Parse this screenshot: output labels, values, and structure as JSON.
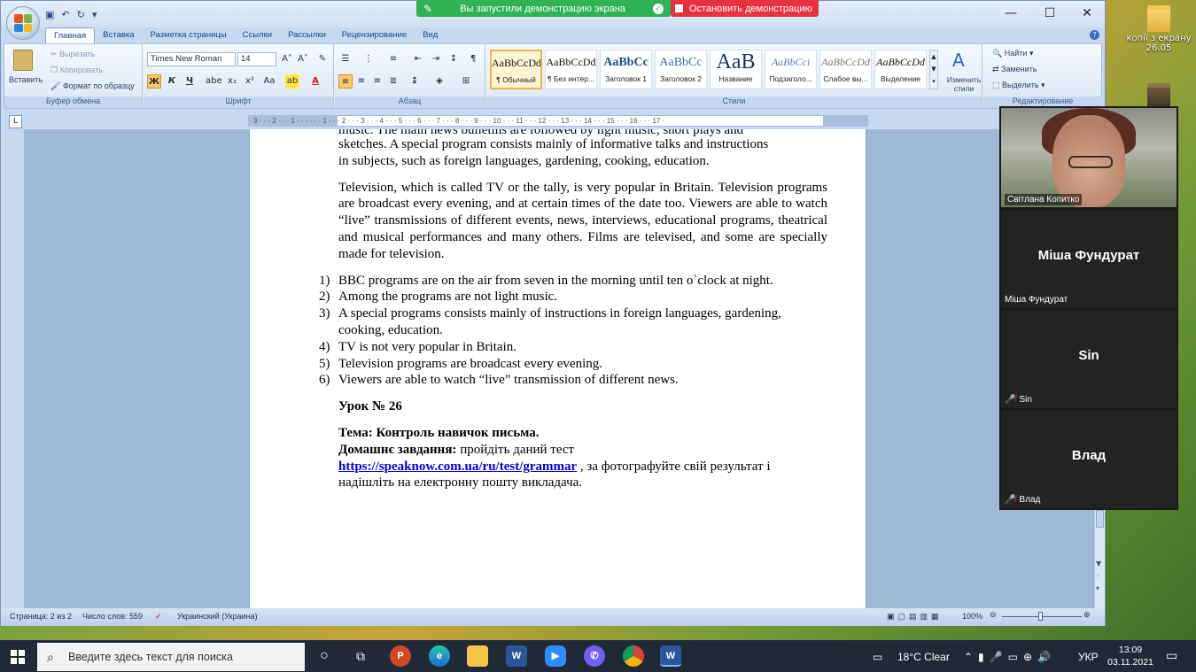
{
  "desktop": {
    "icons": [
      {
        "label": "копії з екрану 26.05"
      }
    ]
  },
  "screen_share": {
    "status": "Вы запустили демонстрацию экрана",
    "stop_label": "Остановить демонстрацию"
  },
  "ribbon": {
    "tabs": [
      "Главная",
      "Вставка",
      "Разметка страницы",
      "Ссылки",
      "Рассылки",
      "Рецензирование",
      "Вид"
    ],
    "clipboard": {
      "paste": "Вставить",
      "cut": "Вырезать",
      "copy": "Копировать",
      "format_painter": "Формат по образцу",
      "label": "Буфер обмена"
    },
    "font": {
      "name": "Times New Roman",
      "size": "14",
      "label": "Шрифт"
    },
    "paragraph": {
      "label": "Абзац"
    },
    "styles": {
      "label": "Стили",
      "items": [
        {
          "sample": "AaBbCcDd",
          "name": "¶ Обычный"
        },
        {
          "sample": "AaBbCcDd",
          "name": "¶ Без интер..."
        },
        {
          "sample": "AaBbCc",
          "name": "Заголовок 1"
        },
        {
          "sample": "AaBbCc",
          "name": "Заголовок 2"
        },
        {
          "sample": "AaB",
          "name": "Название"
        },
        {
          "sample": "AaBbCci",
          "name": "Подзаголо..."
        },
        {
          "sample": "AaBbCcDd",
          "name": "Слабое вы..."
        },
        {
          "sample": "AaBbCcDd",
          "name": "Выделение"
        }
      ],
      "change_styles": "Изменить стили"
    },
    "editing": {
      "find": "Найти",
      "replace": "Заменить",
      "select": "Выделить",
      "label": "Редактирование"
    }
  },
  "ruler": {
    "marks": "· 3 · · · 2 · · · 1 · · · · · · 1 · · · 2 · · · 3 · · · 4 · · · 5 · · · 6 · · · 7 · · · 8 · · · 9 · · · 10 · · · 11 · · · 12 · · · 13 · · · 14 · · · 15 · · · 16 · · · 17 ·"
  },
  "document": {
    "p0_line1": "music. The main news bulletins are followed by light music, short plays and",
    "p0_line2": "sketches. A special program consists mainly of informative talks and instructions",
    "p0_line3": "in subjects, such as foreign languages, gardening, cooking, education.",
    "p1": "Television, which is called TV or the tally, is very popular in Britain. Television programs are broadcast every evening, and at certain times of the date too. Viewers are able to watch “live” transmissions of different events, news, interviews, educational programs, theatrical and musical performances and many others. Films are televised, and some are specially made for television.",
    "list": [
      {
        "num": "1)",
        "text": "BBC programs are on the air from seven in the morning until ten o`clock at night."
      },
      {
        "num": "2)",
        "text": "Among the programs are not light music."
      },
      {
        "num": "3)",
        "text": "A special programs consists mainly of instructions in foreign languages, gardening, cooking, education."
      },
      {
        "num": "4)",
        "text": "TV is not very popular in Britain."
      },
      {
        "num": "5)",
        "text": "Television programs are broadcast every evening."
      },
      {
        "num": "6)",
        "text": "Viewers are able to watch “live” transmission of different news."
      }
    ],
    "lesson": "Урок № 26",
    "topic": "Тема: Контроль навичок письма.",
    "homework_label": "Домашнє завдання:",
    "homework_text": " пройдіть даний тест",
    "link": "https://speaknow.com.ua/ru/test/grammar",
    "after_link": " , за фотографуйте свій результат і надішліть на електронну пошту викладача."
  },
  "status": {
    "page": "Страница: 2 из 2",
    "words": "Число слов: 559",
    "language": "Украинский (Украина)",
    "zoom": "100%"
  },
  "zoom_panel": {
    "participants": [
      {
        "name": "Світлана Копитко",
        "video": true
      },
      {
        "name": "Міша Фундурат",
        "label": "Міша Фундурат",
        "muted": false
      },
      {
        "name": "Sin",
        "label": "Sin",
        "muted": true
      },
      {
        "name": "Влад",
        "label": "Влад",
        "muted": true
      }
    ]
  },
  "taskbar": {
    "search_placeholder": "Введите здесь текст для поиска",
    "weather": "18°C  Clear",
    "lang": "УКР",
    "time": "13:09",
    "date": "03.11.2021"
  },
  "colors": {
    "share_green": "#2fb253",
    "stop_red": "#e8323f",
    "word_blue": "#2b579a"
  }
}
